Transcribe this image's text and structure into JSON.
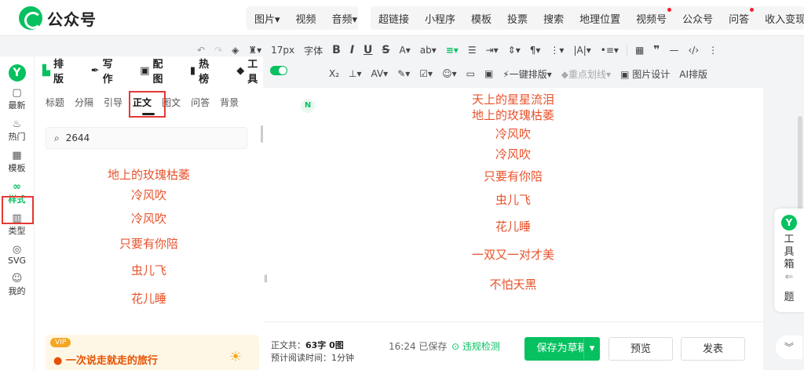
{
  "app": {
    "name": "公众号"
  },
  "topmenu": {
    "group1": [
      "图片▾",
      "视频",
      "音频▾"
    ],
    "group2": [
      "超链接",
      "小程序",
      "模板",
      "投票",
      "搜索",
      "地理位置",
      "视频号",
      "公众号",
      "问答",
      "收入变现"
    ]
  },
  "toolbar1": {
    "font_size": "17px",
    "font_family": "字体",
    "items": [
      "B",
      "I",
      "U",
      "S",
      "A▾",
      "ab▾"
    ]
  },
  "toolbar2": {
    "one_click": "一键排版",
    "highlight": "重点划线",
    "image_design": "图片设计",
    "ai": "AI排版"
  },
  "leftnav": {
    "logo": "Y",
    "items": [
      {
        "label": "最新",
        "icon": "▢"
      },
      {
        "label": "热门",
        "icon": "♨"
      },
      {
        "label": "模板",
        "icon": "▦"
      },
      {
        "label": "样式",
        "icon": "∞"
      },
      {
        "label": "类型",
        "icon": "▥"
      },
      {
        "label": "SVG",
        "icon": "◎"
      },
      {
        "label": "我的",
        "icon": "☺"
      }
    ]
  },
  "panel": {
    "tabs": [
      "排版",
      "写作",
      "配图",
      "热榜",
      "工具"
    ],
    "subtabs": [
      "标题",
      "分隔",
      "引导",
      "正文",
      "图文",
      "问答",
      "背景"
    ],
    "search_value": "2644",
    "lyrics": [
      "地上的玫瑰枯萎",
      "冷风吹",
      "冷风吹",
      "只要有你陪",
      "虫儿飞",
      "花儿睡"
    ],
    "vip_badge": "VIP",
    "vip_text": "一次说走就走的旅行"
  },
  "editor": {
    "lyrics": [
      "天上的星星流泪",
      "地上的玫瑰枯萎",
      "冷风吹",
      "冷风吹",
      "只要有你陪",
      "虫儿飞",
      "花儿睡",
      "一双又一对才美",
      "不怕天黑"
    ]
  },
  "footer": {
    "count_label": "正文共：",
    "count_value": "63字 0图",
    "read_label": "预计阅读时间：",
    "read_value": "1分钟",
    "saved": "16:24 已保存",
    "check": "违规检测",
    "save": "保存为草稿",
    "preview": "预览",
    "publish": "发表"
  },
  "rightbar": {
    "logo": "Y",
    "toolbox": [
      "工",
      "具",
      "箱"
    ],
    "arrow": "⇐",
    "extra": "题",
    "expand": "︾"
  }
}
